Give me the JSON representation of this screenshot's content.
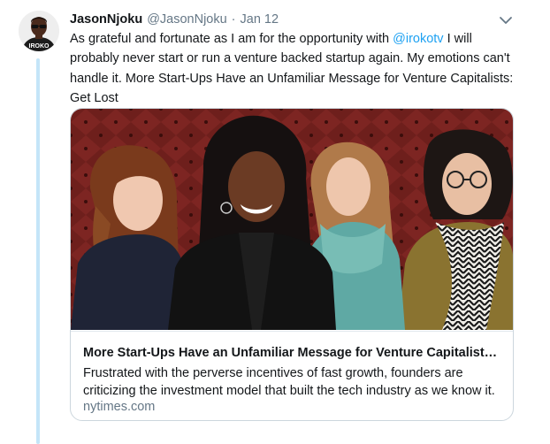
{
  "tweet": {
    "display_name": "JasonNjoku",
    "handle": "@JasonNjoku",
    "separator": "·",
    "timestamp": "Jan 12",
    "text_before_mention": "As grateful and fortunate as I am for the opportunity with ",
    "mention": "@irokotv",
    "text_after_mention": " I will probably never start or run a venture backed startup again. My emotions can't handle it. More Start-Ups Have an Unfamiliar Message for Venture Capitalists: Get Lost",
    "avatar_shirt_text": "IROKO"
  },
  "card": {
    "title": "More Start-Ups Have an Unfamiliar Message for Venture Capitalists: Get Lost",
    "description": "Frustrated with the perverse incentives of fast growth, founders are criticizing the investment model that built the tech industry as we know it.",
    "domain": "nytimes.com"
  },
  "colors": {
    "link": "#1da1f2",
    "secondary_text": "#657786",
    "thread_line": "#c4e5f8",
    "card_border": "#ccd6dd"
  },
  "icons": {
    "caret": "chevron-down-icon"
  }
}
